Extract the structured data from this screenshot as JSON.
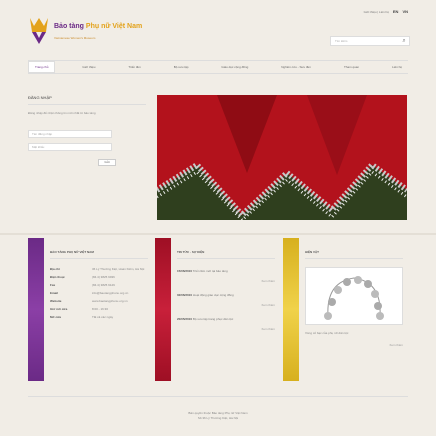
{
  "util": {
    "link": "Giới thiệu | Liên hệ",
    "lang1": "EN",
    "lang2": "VN"
  },
  "logo": {
    "title_a": "Bảo tàng",
    "title_b": "Phụ nữ Việt Nam",
    "tagline": "Vietnamese Women's Museum"
  },
  "search": {
    "placeholder": "Tìm kiếm"
  },
  "nav": [
    "Trang chủ",
    "Giới thiệu",
    "Triển lãm",
    "Bộ sưu tập",
    "Giáo dục cộng đồng",
    "Nghiên cứu - Sưu tầm",
    "Tham quan",
    "Liên hệ"
  ],
  "login": {
    "heading": "ĐĂNG NHẬP",
    "desc": "Đăng nhập để nhận thông tin mới nhất từ bảo tàng",
    "user_placeholder": "Tên đăng nhập",
    "pass_placeholder": "Mật khẩu",
    "button": "Gửi"
  },
  "col1": {
    "heading": "BẢO TÀNG PHỤ NỮ VIỆT NAM",
    "rows": [
      {
        "k": "Địa chỉ",
        "v": "36 Lý Thường Kiệt, Hoàn Kiếm, Hà Nội"
      },
      {
        "k": "Điện thoại",
        "v": "(84.4) 3825 9936"
      },
      {
        "k": "Fax",
        "v": "(84.4) 3825 9129"
      },
      {
        "k": "Email",
        "v": "info@baotangphunu.org.vn"
      },
      {
        "k": "Website",
        "v": "www.baotangphunu.org.vn"
      },
      {
        "k": "Giờ mở cửa",
        "v": "8:00 - 16:30"
      },
      {
        "k": "Mở cửa",
        "v": "Tất cả các ngày"
      }
    ]
  },
  "col2": {
    "heading": "TIN TỨC - SỰ KIỆN",
    "items": [
      {
        "date": "15/06/2010",
        "text": "Triển lãm mới tại bảo tàng"
      },
      {
        "date": "02/06/2010",
        "text": "Hoạt động giáo dục cộng đồng"
      },
      {
        "date": "20/05/2010",
        "text": "Bộ sưu tập trang phục dân tộc"
      }
    ],
    "more": "Xem thêm"
  },
  "col3": {
    "heading": "HIỆN VẬT",
    "caption": "Vòng cổ bạc của phụ nữ dân tộc",
    "more": "Xem thêm"
  },
  "footer": {
    "line1": "Bản quyền thuộc Bảo tàng Phụ nữ Việt Nam",
    "line2": "Số 36 Lý Thường Kiệt, Hà Nội"
  },
  "colors": {
    "purple": "#6b2a86",
    "red": "#b5122a",
    "gold": "#e1c02a",
    "accent": "#e3a21a"
  }
}
